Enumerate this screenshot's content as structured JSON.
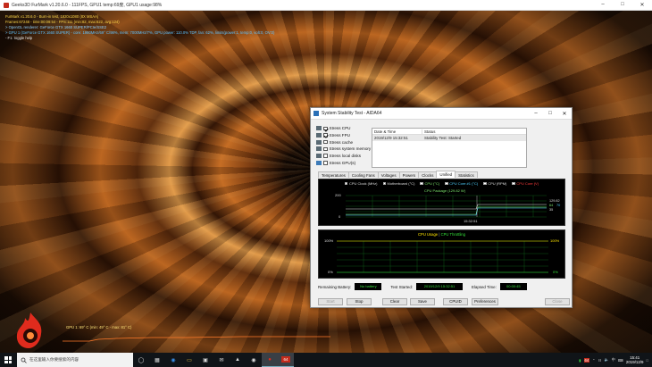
{
  "furmark_window": {
    "title": "Geeks3D FurMark v1.20.6.0 - 111FPS, GPU1 temp:69度, GPU1 usage:98%"
  },
  "overlay": {
    "line1": "FurMark v1.20.6.0 - Burn-in test, 1920x1080 (8X MSAA)",
    "line2": "Frames:67248 - time:00:09:54 - FPS:111 (min:82, max:622, avg:124)",
    "line3": "> OpenGL renderer: GeForce GTX 1660 SUPER/PCIe/SSE2",
    "line4": "> GPU 1 (GeForce GTX 1660 SUPER) - core: 1980MHz/69° C/98%, mem: 7000MHz/7%, GPU power: 110.0% TDP, fan: 62%, limits(power:1, temp:0, volt:0, OV:0)",
    "line5": "- F1: toggle help",
    "gpu_graph_label": "GPU 1: 69° C (min: 49° C - max: 81° C)"
  },
  "dialog": {
    "title": "System Stability Test - AIDA64",
    "stress_items": [
      {
        "label": "Stress CPU",
        "checked": true,
        "name": "stress-cpu"
      },
      {
        "label": "Stress FPU",
        "checked": true,
        "name": "stress-fpu"
      },
      {
        "label": "Stress cache",
        "checked": false,
        "name": "stress-cache"
      },
      {
        "label": "Stress system memory",
        "checked": false,
        "name": "stress-memory"
      },
      {
        "label": "Stress local disks",
        "checked": false,
        "name": "stress-disks"
      },
      {
        "label": "Stress GPU(s)",
        "checked": false,
        "name": "stress-gpus"
      }
    ],
    "log": {
      "col1": "Date & Time",
      "col2": "Status",
      "rows": [
        {
          "time": "2019/12/9 15:32:51",
          "status": "Stability Test: Started"
        }
      ]
    },
    "tabs": [
      "Temperatures",
      "Cooling Fans",
      "Voltages",
      "Powers",
      "Clocks",
      "Unified",
      "Statistics"
    ],
    "active_tab": "Unified",
    "graph1": {
      "legend": [
        {
          "label": "CPU Clock (MHz)",
          "color": "#ffffff"
        },
        {
          "label": "Motherboard (°C)",
          "color": "#ffffff"
        },
        {
          "label": "CPU (°C)",
          "color": "#7be36b"
        },
        {
          "label": "CPU Core #1 (°C)",
          "color": "#4fd0ff"
        },
        {
          "label": "CPU (RPM)",
          "color": "#ffffff"
        },
        {
          "label": "CPU Core (V)",
          "color": "#ff3b3b"
        }
      ],
      "legend2": "CPU Package (129.82 W)",
      "y_top": "200",
      "y_bottom": "0",
      "time_label": "15:32:51",
      "right_values": [
        "129.82",
        "64",
        "70",
        "35"
      ]
    },
    "graph2": {
      "title_usage": "CPU Usage",
      "title_throttle": "CPU Throttling",
      "left_top": "100%",
      "left_bottom": "0%",
      "right_top": "100%",
      "right_bottom": "0%"
    },
    "bottom": {
      "battery_label": "Remaining Battery:",
      "battery_value": "No battery",
      "started_label": "Test Started:",
      "started_value": "2019/12/9 15:32:51",
      "elapsed_label": "Elapsed Time:",
      "elapsed_value": "00:00:45"
    },
    "buttons": {
      "start": "Start",
      "stop": "Stop",
      "clear": "Clear",
      "save": "Save",
      "cpuid": "CPUID",
      "preferences": "Preferences",
      "close": "Close"
    }
  },
  "taskbar": {
    "search_placeholder": "在这里输入你要搜索的内容",
    "time": "15:41",
    "date": "2019/12/9",
    "tray_lang": "中",
    "gpu_badge": "64"
  },
  "colors": {
    "usage": "#ffe400",
    "throttle": "#35e03a",
    "grid": "#0f6b1a"
  }
}
